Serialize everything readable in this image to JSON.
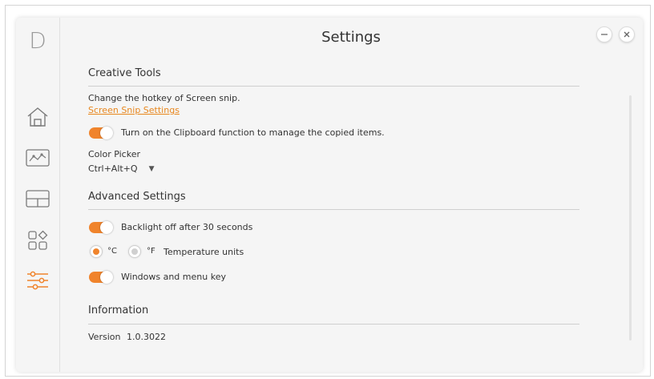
{
  "app": {
    "logo_letter": "D",
    "title": "Settings"
  },
  "colors": {
    "accent": "#f0842c",
    "link": "#e8871e",
    "icon": "#7a7a7a"
  },
  "sidebar": {
    "items": [
      {
        "name": "home",
        "icon": "home-icon"
      },
      {
        "name": "screen-snip",
        "icon": "snip-icon"
      },
      {
        "name": "layout",
        "icon": "layout-icon"
      },
      {
        "name": "apps",
        "icon": "apps-icon"
      },
      {
        "name": "settings",
        "icon": "sliders-icon",
        "active": true
      }
    ]
  },
  "window_controls": {
    "minimize": "minimize-icon",
    "close": "close-icon"
  },
  "creative_tools": {
    "heading": "Creative Tools",
    "hotkey_text": "Change the hotkey of Screen snip.",
    "snip_link": "Screen Snip Settings",
    "clipboard_label": "Turn on the Clipboard function to manage the copied items.",
    "clipboard_on": true,
    "color_picker_label": "Color Picker",
    "color_picker_value": "Ctrl+Alt+Q",
    "dropdown_arrow": "▼"
  },
  "advanced": {
    "heading": "Advanced Settings",
    "backlight_label": "Backlight off after 30 seconds",
    "backlight_on": true,
    "celsius_label": "°C",
    "fahrenheit_label": "°F",
    "temperature_selected": "°C",
    "temperature_label": "Temperature units",
    "winkey_label": "Windows and menu key",
    "winkey_on": true
  },
  "information": {
    "heading": "Information",
    "version_label": "Version",
    "version_value": "1.0.3022"
  }
}
